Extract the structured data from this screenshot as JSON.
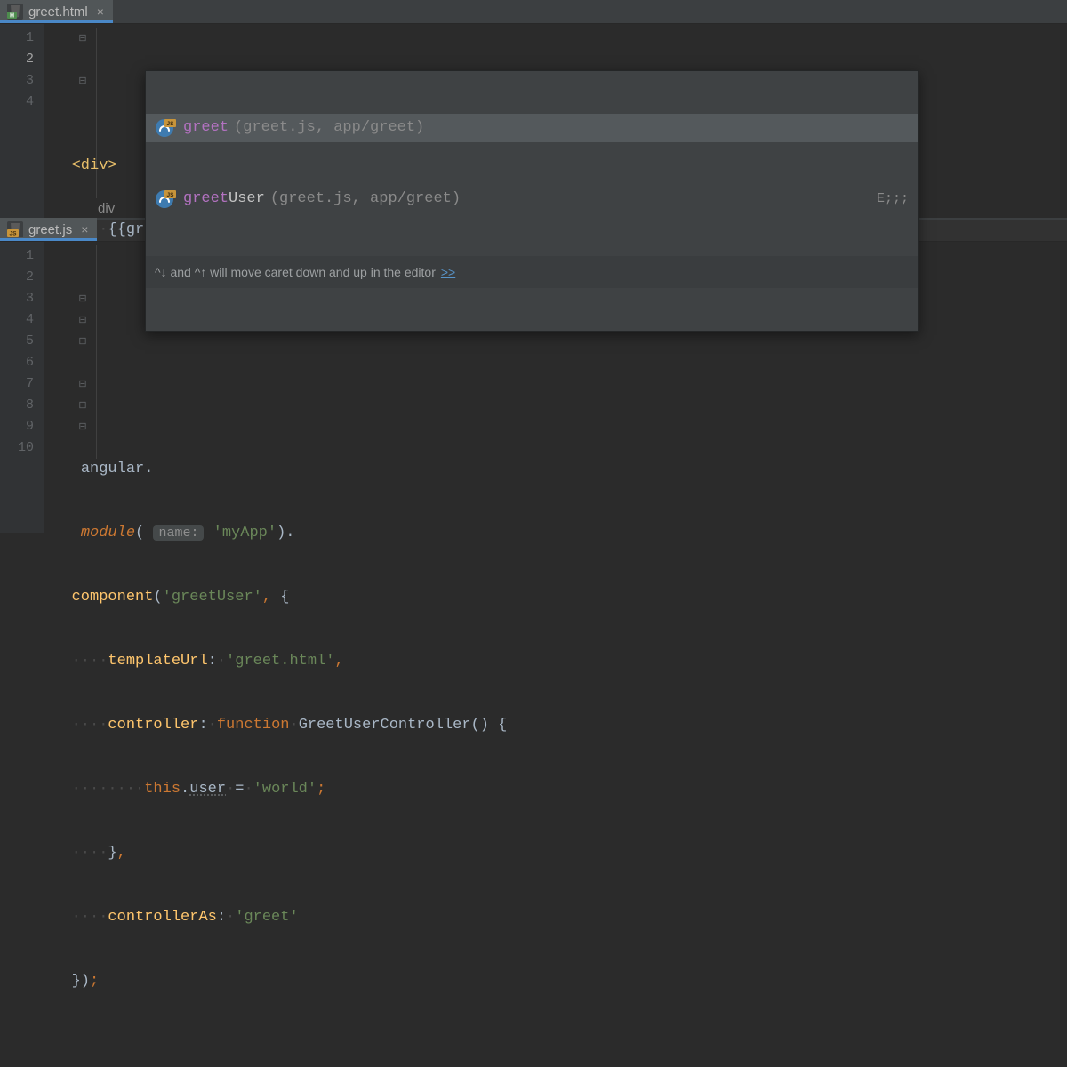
{
  "pane1": {
    "tab": {
      "filename": "greet.html",
      "type": "html",
      "active": true
    },
    "gutter": [
      "1",
      "2",
      "3",
      "4"
    ],
    "code": {
      "l1": "<div>",
      "l2_expr": "{{greet}}",
      "l3_open": "<"
    },
    "breadcrumb": "div"
  },
  "autocomplete": {
    "items": [
      {
        "match": "greet",
        "rest": "",
        "location": "(greet.js, app/greet)",
        "tail": "",
        "selected": true
      },
      {
        "match": "greet",
        "rest": "User",
        "location": "(greet.js, app/greet)",
        "tail": "E;;;",
        "selected": false
      }
    ],
    "hint_prefix": "^↓ and ^↑ will move caret down and up in the editor",
    "hint_link": ">>"
  },
  "pane2": {
    "tab": {
      "filename": "greet.js",
      "type": "js",
      "active": true
    },
    "gutter": [
      "1",
      "2",
      "3",
      "4",
      "5",
      "6",
      "7",
      "8",
      "9",
      "10"
    ],
    "code": {
      "l1_obj": "angular",
      "l2_fn": "module",
      "l2_param": "name:",
      "l2_str": "'myApp'",
      "l3_fn": "component",
      "l3_str": "'greetUser'",
      "l4_key": "templateUrl",
      "l4_str": "'greet.html'",
      "l5_key": "controller",
      "l5_kw": "function",
      "l5_name": "GreetUserController",
      "l6_this": "this",
      "l6_prop": "user",
      "l6_str": "'world'",
      "l8_key": "controllerAs",
      "l8_str": "'greet'"
    }
  }
}
